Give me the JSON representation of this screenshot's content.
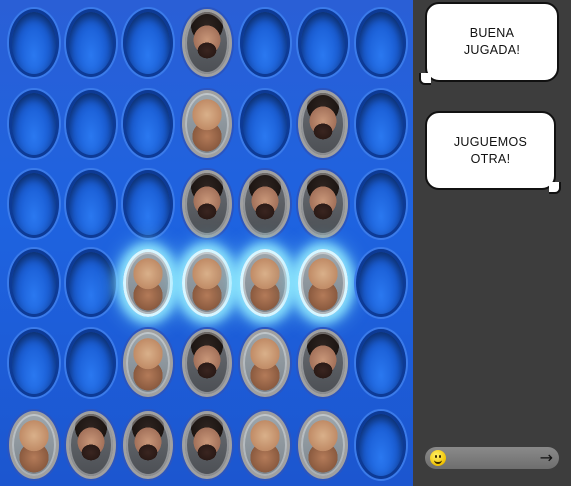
{
  "board": {
    "rows": [
      [
        "empty",
        "empty",
        "empty",
        "bearded",
        "empty",
        "empty",
        "empty"
      ],
      [
        "empty",
        "empty",
        "empty",
        "bald",
        "empty",
        "bearded",
        "empty"
      ],
      [
        "empty",
        "empty",
        "empty",
        "bearded",
        "bearded",
        "bearded",
        "empty"
      ],
      [
        "empty",
        "empty",
        "bald-win",
        "bald-win",
        "bald-win",
        "bald-win",
        "empty"
      ],
      [
        "empty",
        "empty",
        "bald",
        "bearded",
        "bald",
        "bearded",
        "empty"
      ],
      [
        "bald",
        "bearded",
        "bearded",
        "bearded",
        "bald",
        "bald",
        "empty"
      ]
    ]
  },
  "messages": [
    {
      "line1": "BUENA",
      "line2": "JUGADA!"
    },
    {
      "line1": "JUGUEMOS",
      "line2": "OTRA!"
    }
  ],
  "chat": {
    "emoji_icon": "smiley-icon",
    "send_icon": "arrow-right-icon",
    "send_glyph": "→"
  }
}
